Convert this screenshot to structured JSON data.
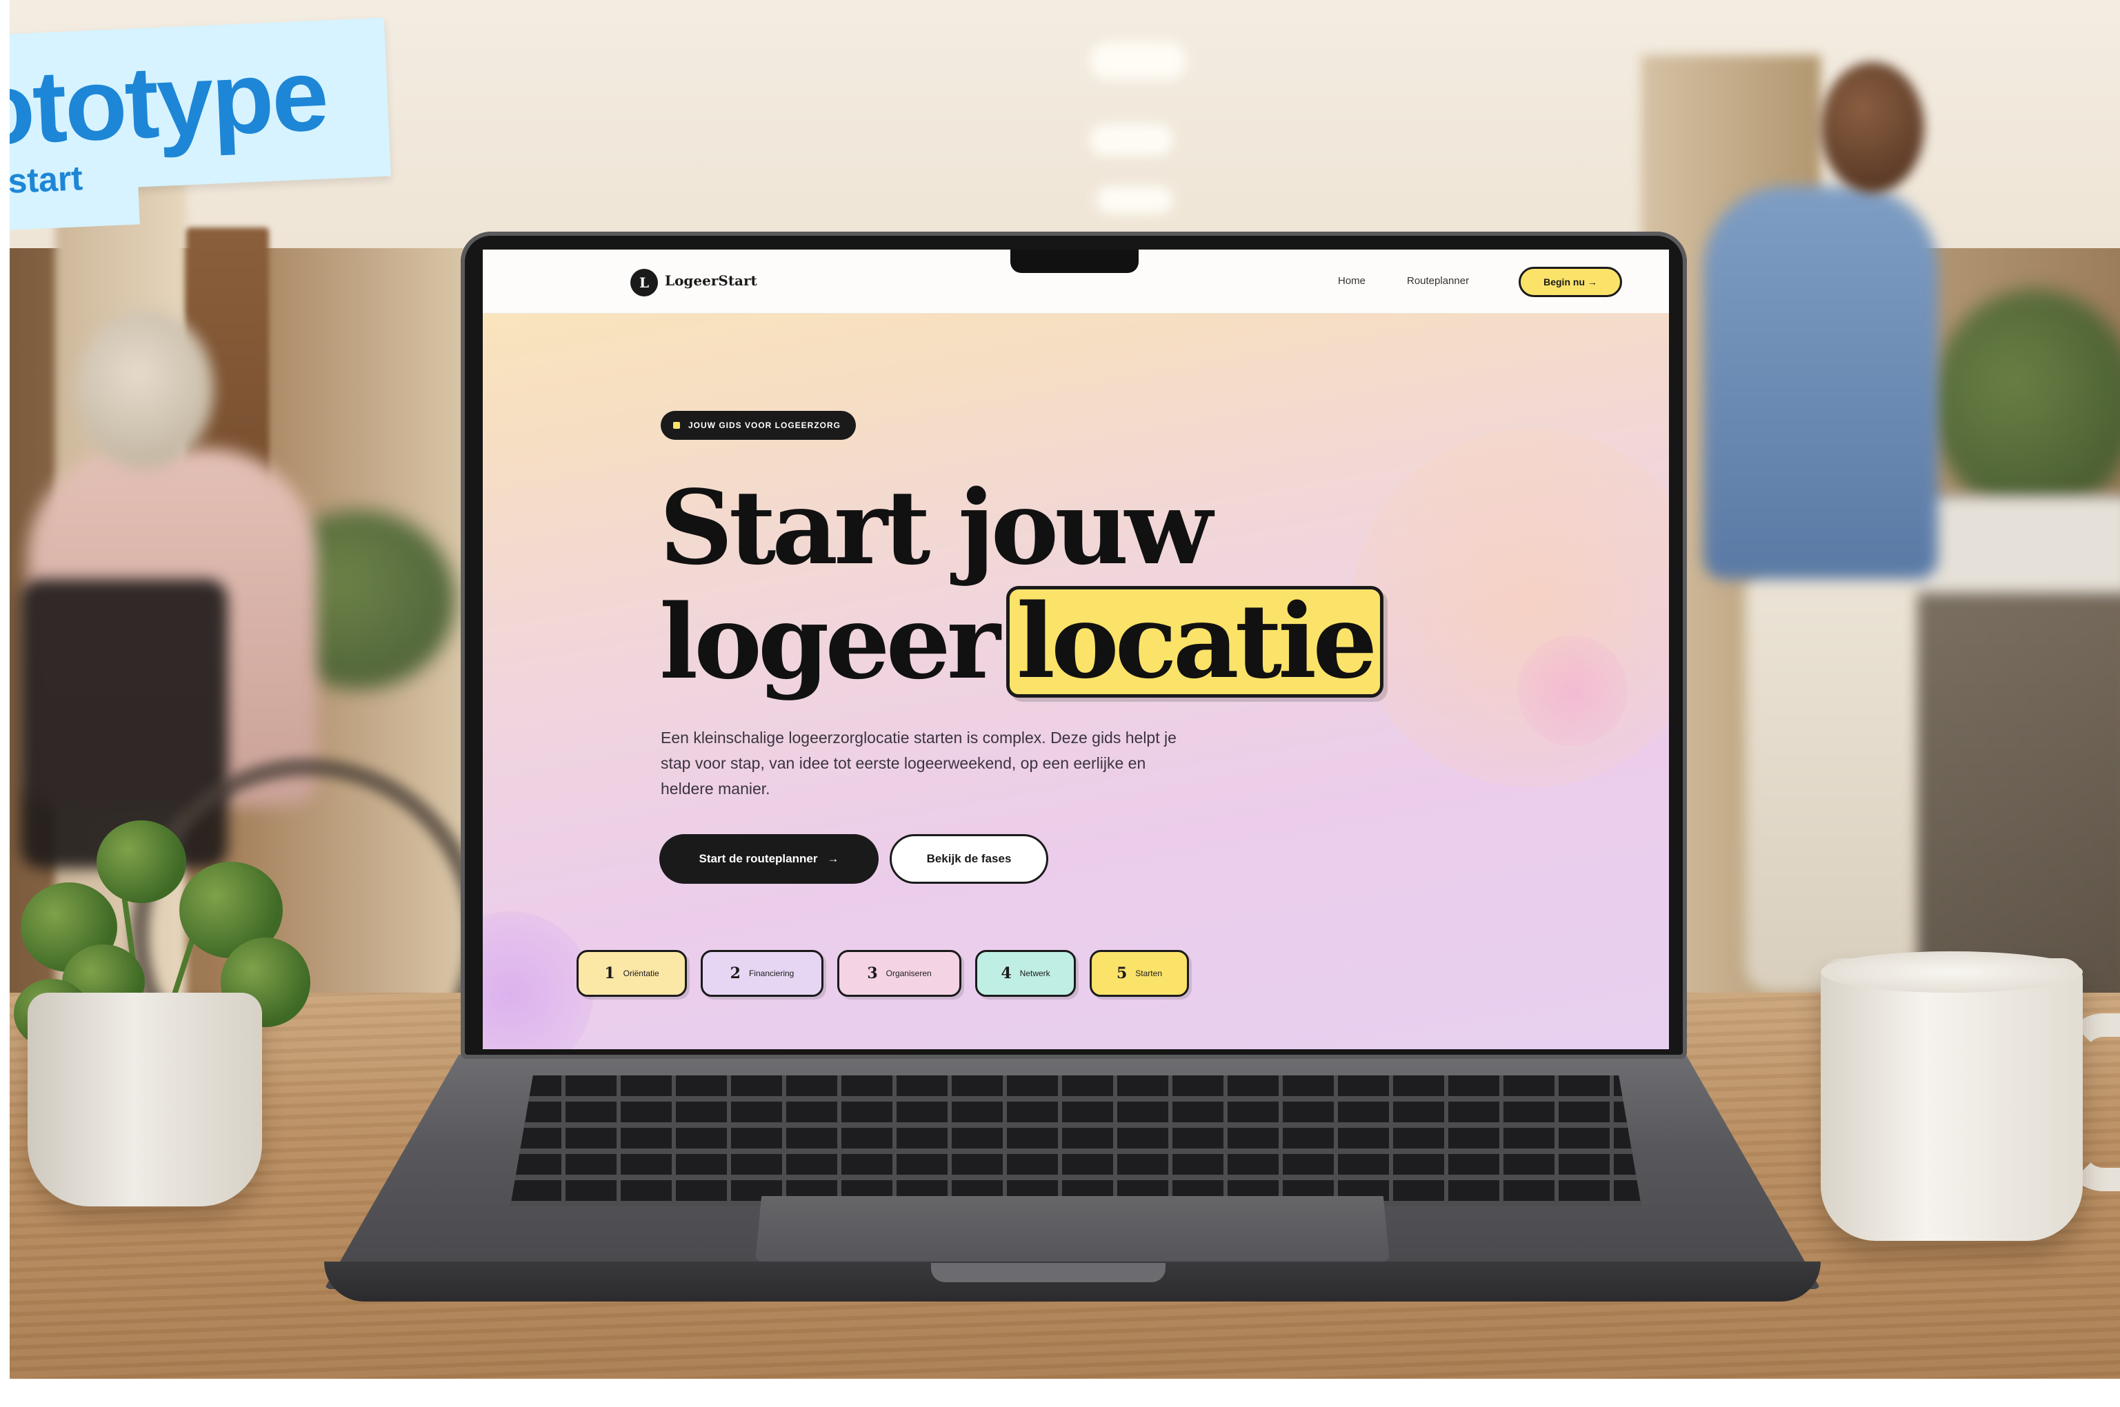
{
  "sticker": {
    "title": "ototype",
    "subtitle": "rstart"
  },
  "site": {
    "logo_letter": "L",
    "logo_text": "LogeerStart",
    "nav": {
      "home": "Home",
      "routeplanner": "Routeplanner",
      "cta": "Begin nu →"
    },
    "hero": {
      "eyebrow": "JOUW GIDS VOOR LOGEERZORG",
      "headline_line1": "Start jouw",
      "headline_line2_word1": "logeer",
      "headline_highlight": "locatie",
      "intro": "Een kleinschalige logeerzorglocatie starten is complex. Deze gids helpt je stap voor stap, van idee tot eerste logeerweekend, op een eerlijke en heldere manier.",
      "primary_button": "Start de routeplanner",
      "primary_button_icon": "→",
      "secondary_button": "Bekijk de fases"
    },
    "phases": [
      {
        "number": "1",
        "label": "Oriëntatie",
        "color": "#fbe7a6"
      },
      {
        "number": "2",
        "label": "Financiering",
        "color": "#e6d6f3"
      },
      {
        "number": "3",
        "label": "Organiseren",
        "color": "#f4d3e4"
      },
      {
        "number": "4",
        "label": "Netwerk",
        "color": "#bfeee4"
      },
      {
        "number": "5",
        "label": "Starten",
        "color": "#fbe36a"
      }
    ]
  },
  "colors": {
    "accent_yellow": "#fbe36a",
    "ink": "#1a1a1a",
    "sticker_blue": "#1e86d6",
    "sticker_bg": "#d6f3ff"
  }
}
